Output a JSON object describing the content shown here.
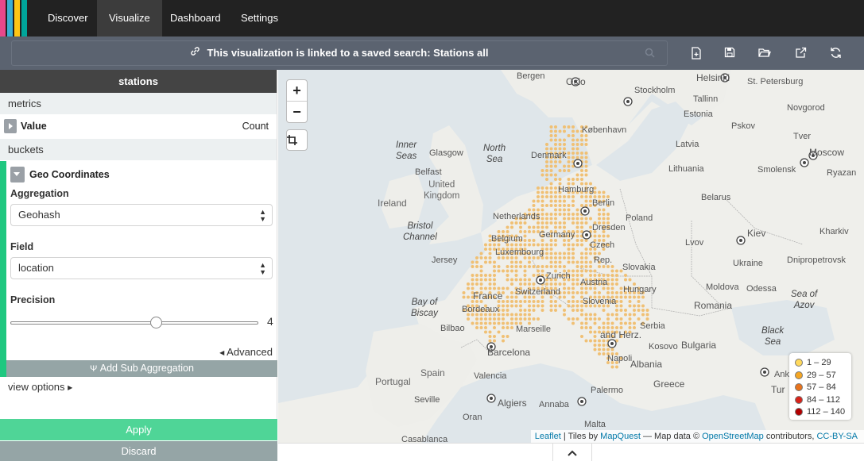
{
  "nav": {
    "logo_colors": [
      "#e8488b",
      "#3caed2",
      "#fec514",
      "#00a69b"
    ],
    "items": [
      {
        "label": "Discover"
      },
      {
        "label": "Visualize"
      },
      {
        "label": "Dashboard"
      },
      {
        "label": "Settings"
      }
    ],
    "active": "Visualize"
  },
  "searchbar": {
    "linked_prefix": "This visualization is linked to a saved search:",
    "search_name": "Stations all",
    "toolbar_icons": [
      "new-document-icon",
      "save-icon",
      "open-folder-icon",
      "share-icon",
      "refresh-icon"
    ]
  },
  "sidebar": {
    "title": "stations",
    "metrics_label": "metrics",
    "metric": {
      "name": "Value",
      "type": "Count"
    },
    "buckets_label": "buckets",
    "bucket": {
      "name": "Geo Coordinates",
      "aggregation_label": "Aggregation",
      "aggregation_value": "Geohash",
      "field_label": "Field",
      "field_value": "location",
      "precision_label": "Precision",
      "precision_value": "4",
      "advanced_label": "Advanced",
      "add_sub_label": "Add Sub Aggregation"
    },
    "view_options_label": "view options",
    "apply_label": "Apply",
    "discard_label": "Discard"
  },
  "map": {
    "zoom_in": "+",
    "zoom_out": "−",
    "legend": [
      {
        "label": "1 – 29",
        "color": "#ffd95c"
      },
      {
        "label": "29 – 57",
        "color": "#f5a623"
      },
      {
        "label": "57 – 84",
        "color": "#e8731c"
      },
      {
        "label": "84 – 112",
        "color": "#d8231a"
      },
      {
        "label": "112 – 140",
        "color": "#b20000"
      }
    ],
    "attribution": {
      "leaflet": "Leaflet",
      "tiles_by": "| Tiles by",
      "mapquest": "MapQuest",
      "map_data": "— Map data ©",
      "osm": "OpenStreetMap",
      "contributors": "contributors,",
      "license": "CC-BY-SA"
    },
    "labels": {
      "bergen": "Bergen",
      "oslo": "Oslo",
      "stockholm": "Stockholm",
      "helsinki": "Helsinki",
      "st_petersburg": "St. Petersburg",
      "tallinn": "Tallinn",
      "estonia": "Estonia",
      "pskov": "Pskov",
      "novgorod": "Novgorod",
      "kobenhavn": "København",
      "denmark": "Denmark",
      "latvia": "Latvia",
      "tver": "Tver",
      "moscow": "Moscow",
      "inner_seas": "Inner\nSeas",
      "north_sea": "North\nSea",
      "glasgow": "Glasgow",
      "belfast": "Belfast",
      "united_kingdom": "United\nKingdom",
      "ireland": "Ireland",
      "hamburg": "Hamburg",
      "berlin": "Berlin",
      "lithuania": "Lithuania",
      "smolensk": "Smolensk",
      "ryazan": "Ryazan",
      "belarus": "Belarus",
      "bristol_channel": "Bristol\nChannel",
      "netherlands": "Netherlands",
      "poland": "Poland",
      "dresden": "Dresden",
      "belgium": "Belgium",
      "germany": "Germany",
      "lvov": "Lvov",
      "kiev": "Kiev",
      "kharkiv": "Kharkiv",
      "jersey": "Jersey",
      "luxembourg": "Luxembourg",
      "czech": "Czech",
      "rep": "Rep.",
      "slovakia": "Slovakia",
      "ukraine": "Ukraine",
      "dnipropetrovsk": "Dnipropetrovsk",
      "zurich": "Zurich",
      "austria": "Austria",
      "france": "France",
      "switzerland": "Switzerland",
      "slovenia": "Slovenia",
      "hungary": "Hungary",
      "moldova": "Moldova",
      "odessa": "Odessa",
      "bay_of_biscay": "Bay of\nBiscay",
      "bordeaux": "Bordeaux",
      "romania": "Romania",
      "sea_of_azov": "Sea of\nAzov",
      "serbia": "Serbia",
      "and_herz": "and Herz.",
      "black_sea": "Black\nSea",
      "bilbao": "Bilbao",
      "marseille": "Marseille",
      "kosovo": "Kosovo",
      "bulgaria": "Bulgaria",
      "barcelona": "Barcelona",
      "spain": "Spain",
      "valencia": "Valencia",
      "napoli": "Napoli",
      "albania": "Albania",
      "portugal": "Portugal",
      "ankara": "Ankara",
      "seville": "Seville",
      "greece": "Greece",
      "algiers": "Algiers",
      "annaba": "Annaba",
      "palermo": "Palermo",
      "oran": "Oran",
      "malta": "Malta",
      "casablanca": "Casablanca",
      "tur": "Tur"
    }
  }
}
